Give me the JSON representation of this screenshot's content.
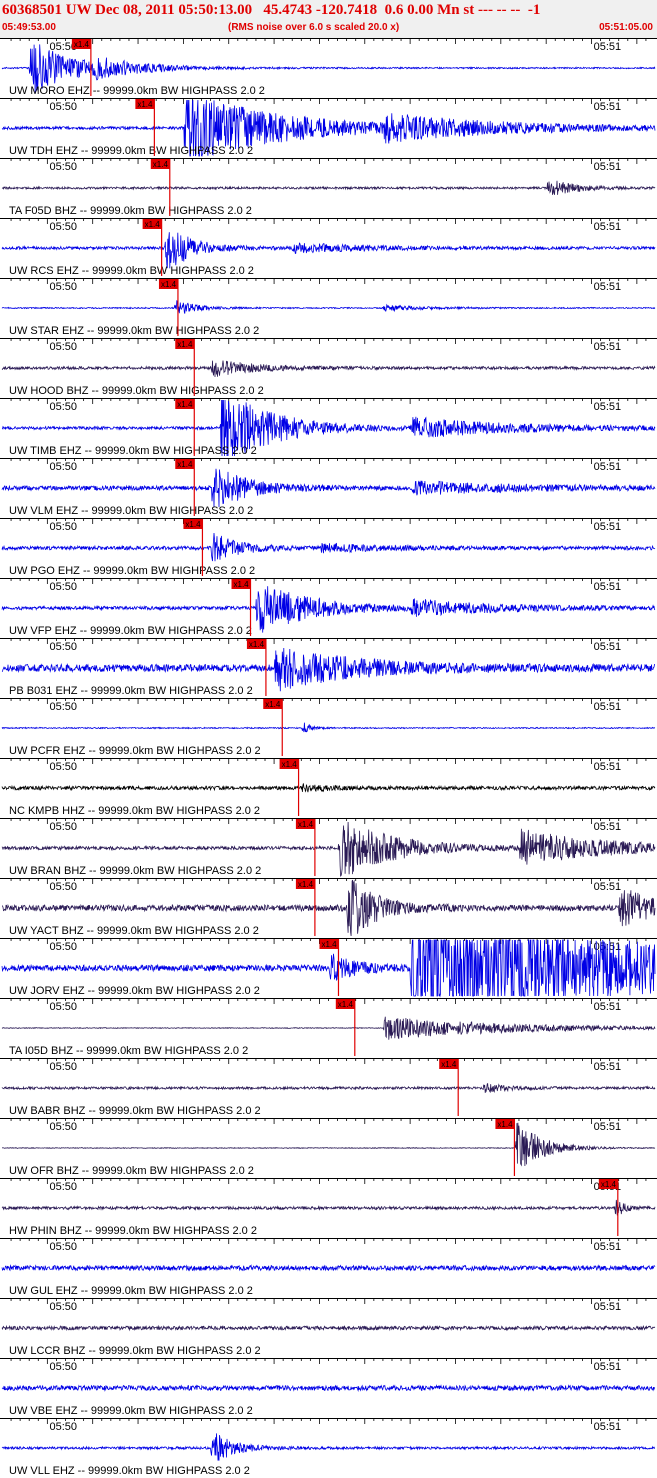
{
  "header": {
    "title": "60368501 UW Dec 08, 2011 05:50:13.00   45.4743 -120.7418  0.6 0.00 Mn st --- -- --  -1",
    "start_time": "05:49:53.00",
    "noise_note": "(RMS noise over 6.0 s scaled 20.0 x)",
    "end_time": "05:51:05.00"
  },
  "colors": {
    "header_text": "#e00000",
    "pick": "#e00000",
    "blue": "#0000e6",
    "dark": "#2a1a55",
    "black": "#000000"
  },
  "chart_data": {
    "type": "line",
    "title": "60368501 UW Dec 08, 2011 05:50:13.00   45.4743 -120.7418  0.6 0.00 Mn st --- -- --  -1",
    "xlabel": "",
    "ylabel": "",
    "x_range": [
      "05:49:53.00",
      "05:51:05.00"
    ],
    "tick_labels": [
      "05:50",
      "05:51"
    ],
    "tick_seconds": [
      7,
      67
    ],
    "pick_label": "x1.4",
    "traces": [
      {
        "label": "UW MORO EHZ -- 99999.0km BW  HIGHPASS  2.0  2",
        "color": "blue",
        "pick_s": 9.8,
        "bursts": [
          [
            3,
            10,
            2.5
          ],
          [
            10,
            12,
            0.6
          ]
        ],
        "noise": 0.06
      },
      {
        "label": "UW TDH EHZ -- 99999.0km BW  HIGHPASS  2.0  2",
        "color": "blue",
        "pick_s": 16.8,
        "bursts": [
          [
            20,
            22,
            3.2
          ],
          [
            42,
            30,
            0.9
          ]
        ],
        "noise": 0.12
      },
      {
        "label": "TA F05D BHZ -- 99999.0km BW  HIGHPASS  2.0  2",
        "color": "dark",
        "pick_s": 18.5,
        "bursts": [
          [
            60,
            6,
            0.8
          ]
        ],
        "noise": 0.09
      },
      {
        "label": "UW RCS EHZ -- 99999.0km BW  HIGHPASS  2.0  2",
        "color": "blue",
        "pick_s": 17.6,
        "bursts": [
          [
            18,
            6,
            2.2
          ],
          [
            32,
            20,
            0.35
          ]
        ],
        "noise": 0.12
      },
      {
        "label": "UW STAR EHZ -- 99999.0km BW  HIGHPASS  2.0  2",
        "color": "blue",
        "pick_s": 19.4,
        "bursts": [
          [
            19,
            5,
            0.7
          ],
          [
            42,
            10,
            0.25
          ]
        ],
        "noise": 0.05
      },
      {
        "label": "UW HOOD BHZ -- 99999.0km BW  HIGHPASS  2.0  2",
        "color": "dark",
        "pick_s": 21.2,
        "bursts": [
          [
            23,
            9,
            0.8
          ]
        ],
        "noise": 0.12
      },
      {
        "label": "UW TIMB EHZ -- 99999.0km BW  HIGHPASS  2.0  2",
        "color": "blue",
        "pick_s": 21.2,
        "bursts": [
          [
            24,
            12,
            3.5
          ],
          [
            45,
            25,
            0.8
          ]
        ],
        "noise": 0.12
      },
      {
        "label": "UW VLM EHZ -- 99999.0km BW  HIGHPASS  2.0  2",
        "color": "blue",
        "pick_s": 21.2,
        "bursts": [
          [
            23,
            8,
            2.0
          ],
          [
            45,
            25,
            0.5
          ]
        ],
        "noise": 0.18
      },
      {
        "label": "UW PGO EHZ -- 99999.0km BW  HIGHPASS  2.0  2",
        "color": "blue",
        "pick_s": 22.1,
        "bursts": [
          [
            23,
            6,
            1.4
          ],
          [
            35,
            15,
            0.3
          ]
        ],
        "noise": 0.15
      },
      {
        "label": "UW VFP EHZ -- 99999.0km BW  HIGHPASS  2.0  2",
        "color": "blue",
        "pick_s": 27.4,
        "bursts": [
          [
            28,
            12,
            2.4
          ],
          [
            45,
            22,
            0.6
          ]
        ],
        "noise": 0.14
      },
      {
        "label": "PB B031 EHZ -- 99999.0km BW  HIGHPASS  2.0  2",
        "color": "blue",
        "pick_s": 29.1,
        "bursts": [
          [
            30,
            18,
            1.8
          ]
        ],
        "noise": 0.3
      },
      {
        "label": "UW PCFR EHZ -- 99999.0km BW  HIGHPASS  2.0  2",
        "color": "blue",
        "pick_s": 30.9,
        "bursts": [
          [
            33,
            2,
            0.6
          ]
        ],
        "noise": 0.05
      },
      {
        "label": "NC KMPB HHZ -- 99999.0km BW  HIGHPASS  2.0  2",
        "color": "black",
        "pick_s": 32.7,
        "bursts": [
          [
            33,
            5,
            0.35
          ]
        ],
        "noise": 0.15
      },
      {
        "label": "UW BRAN BHZ -- 99999.0km BW  HIGHPASS  2.0  2",
        "color": "dark",
        "pick_s": 34.5,
        "bursts": [
          [
            37,
            12,
            2.8
          ],
          [
            57,
            20,
            1.5
          ]
        ],
        "noise": 0.14
      },
      {
        "label": "UW YACT BHZ -- 99999.0km BW  HIGHPASS  2.0  2",
        "color": "dark",
        "pick_s": 34.5,
        "bursts": [
          [
            38,
            6,
            3.3
          ],
          [
            68,
            8,
            1.8
          ]
        ],
        "noise": 0.25
      },
      {
        "label": "UW JORV EHZ -- 99999.0km BW  HIGHPASS  2.0  2",
        "color": "blue",
        "pick_s": 37.1,
        "bursts": [
          [
            36,
            6,
            1.2
          ],
          [
            45,
            60,
            5.0
          ]
        ],
        "noise": 0.25
      },
      {
        "label": "TA I05D BHZ -- 99999.0km BW  HIGHPASS  2.0  2",
        "color": "dark",
        "pick_s": 38.9,
        "bursts": [
          [
            42,
            30,
            1.0
          ]
        ],
        "noise": 0.03
      },
      {
        "label": "UW BABR BHZ -- 99999.0km BW  HIGHPASS  2.0  2",
        "color": "dark",
        "pick_s": 50.3,
        "bursts": [
          [
            53,
            6,
            0.35
          ]
        ],
        "noise": 0.1
      },
      {
        "label": "UW OFR BHZ -- 99999.0km BW  HIGHPASS  2.0  2",
        "color": "dark",
        "pick_s": 56.5,
        "bursts": [
          [
            56.5,
            6,
            2.6
          ]
        ],
        "noise": 0.03
      },
      {
        "label": "HW PHIN BHZ -- 99999.0km BW  HIGHPASS  2.0  2",
        "color": "dark",
        "pick_s": 67.9,
        "bursts": [
          [
            67.5,
            2,
            1.0
          ]
        ],
        "noise": 0.12
      },
      {
        "label": "UW GUL EHZ -- 99999.0km BW  HIGHPASS  2.0  2",
        "color": "blue",
        "pick_s": null,
        "bursts": [],
        "noise": 0.2
      },
      {
        "label": "UW LCCR BHZ -- 99999.0km BW  HIGHPASS  2.0  2",
        "color": "dark",
        "pick_s": null,
        "bursts": [],
        "noise": 0.15
      },
      {
        "label": "UW VBE EHZ -- 99999.0km BW  HIGHPASS  2.0  2",
        "color": "blue",
        "pick_s": null,
        "bursts": [],
        "noise": 0.2
      },
      {
        "label": "UW VLL EHZ -- 99999.0km BW  HIGHPASS  2.0  2",
        "color": "blue",
        "pick_s": null,
        "bursts": [
          [
            23,
            5,
            1.5
          ]
        ],
        "noise": 0.1
      }
    ]
  }
}
